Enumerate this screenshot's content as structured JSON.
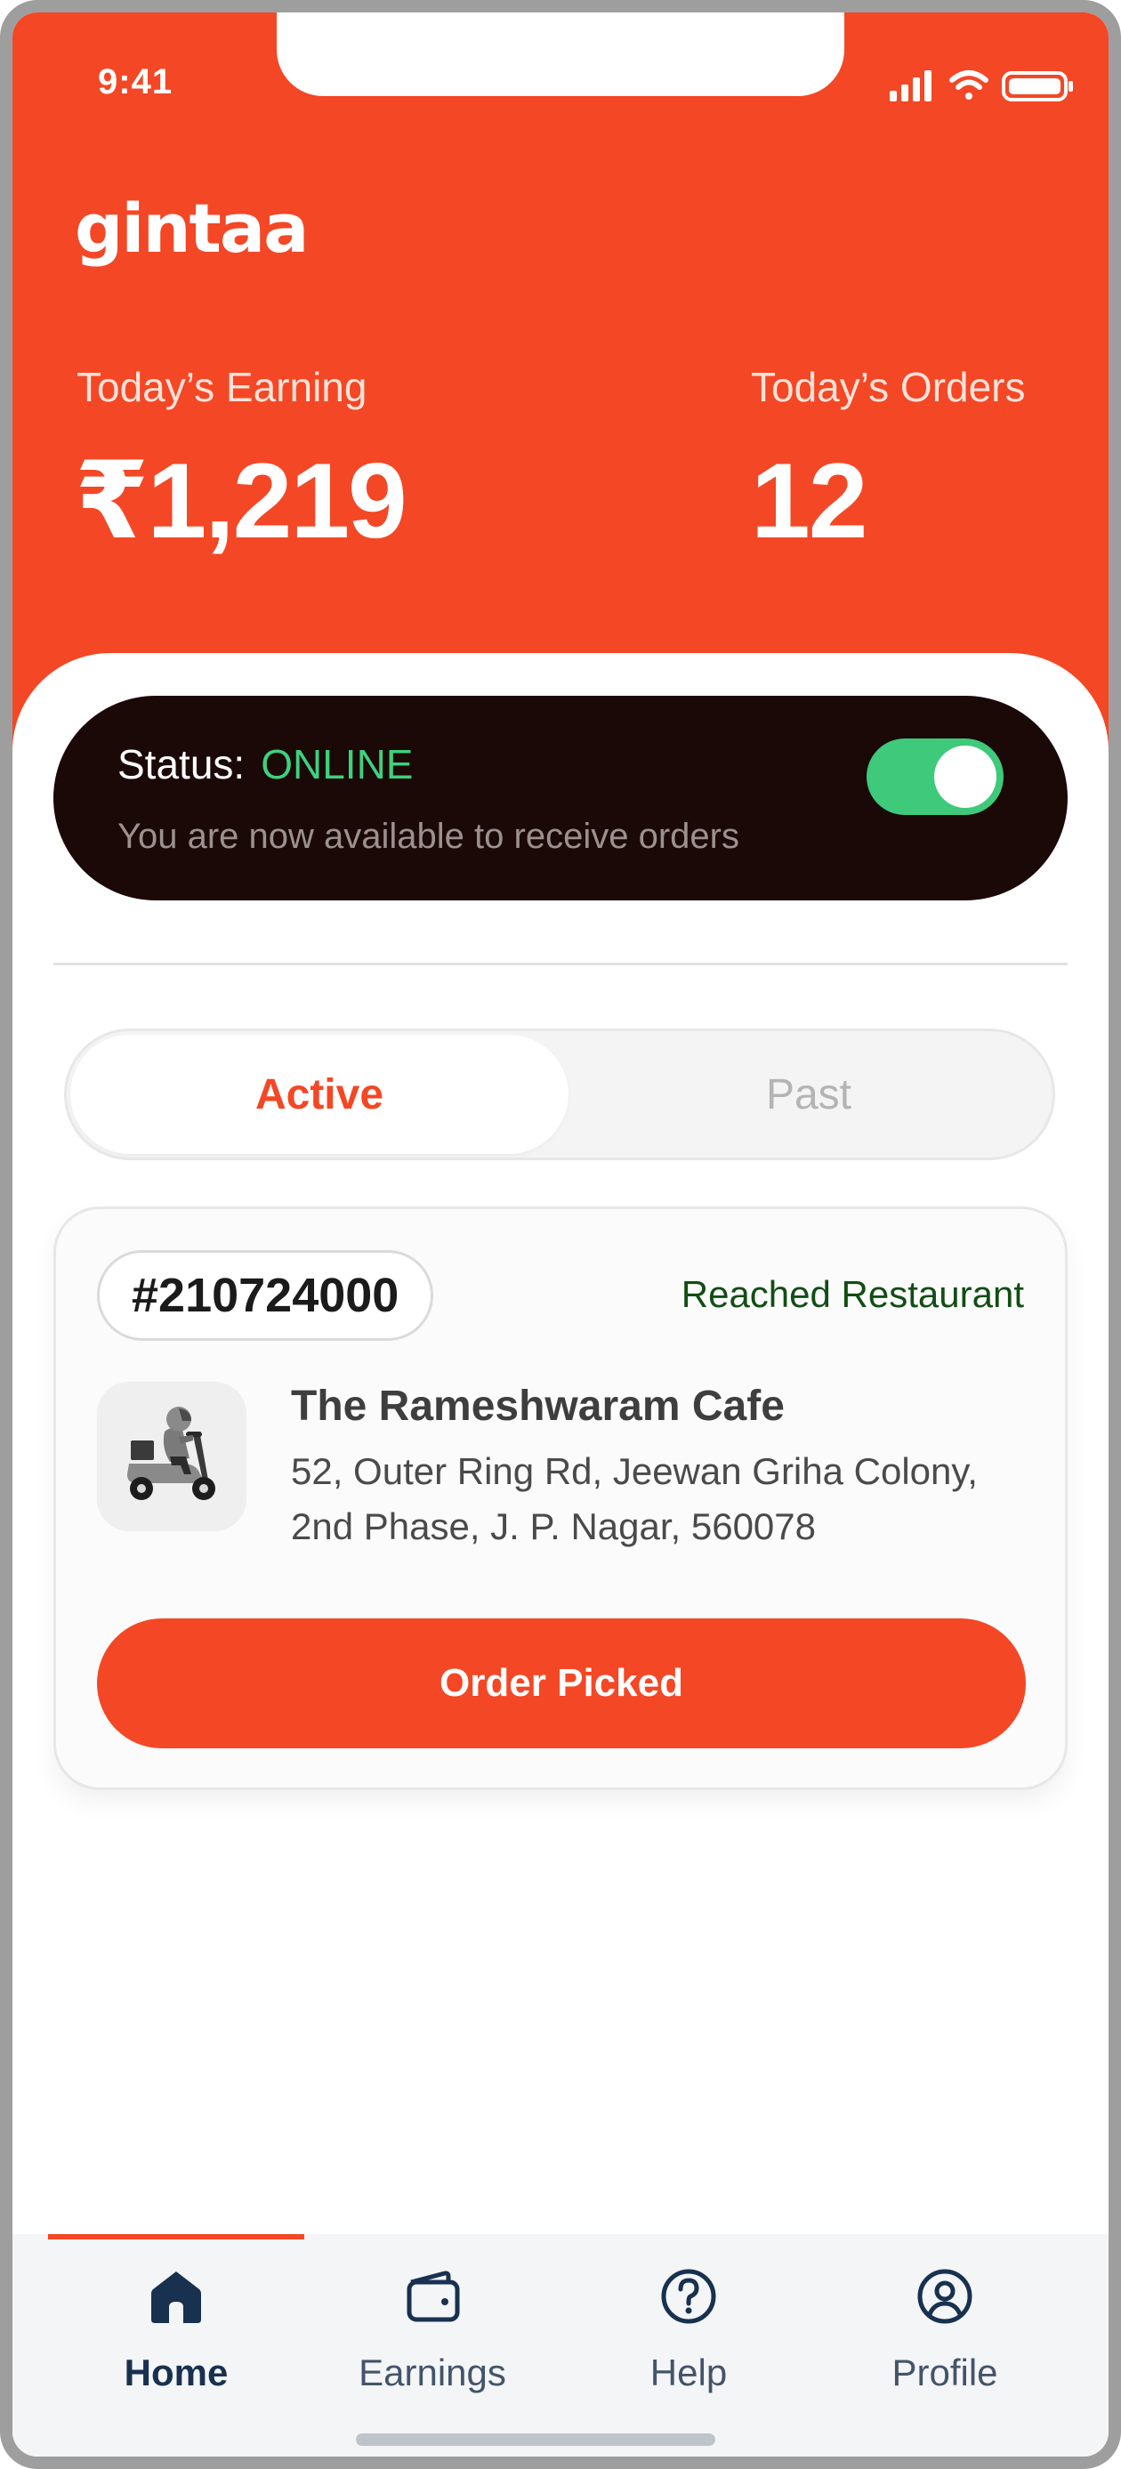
{
  "status_bar": {
    "time": "9:41"
  },
  "header": {
    "logo": "gintaa",
    "earning_label": "Today’s Earning",
    "earning_value": "₹1,219",
    "orders_label": "Today’s Orders",
    "orders_value": "12"
  },
  "status_card": {
    "label": "Status:",
    "value": "ONLINE",
    "subtitle": "You are now available to receive orders",
    "toggle_on": true
  },
  "tabs": [
    {
      "label": "Active",
      "selected": true
    },
    {
      "label": "Past",
      "selected": false
    }
  ],
  "order": {
    "id": "#210724000",
    "status": "Reached Restaurant",
    "restaurant_name": "The Rameshwaram Cafe",
    "address": "52, Outer Ring Rd, Jeewan Griha Colony, 2nd Phase, J. P. Nagar, 560078",
    "action_label": "Order Picked",
    "icon": "scooter-rider-icon"
  },
  "bottom_nav": [
    {
      "label": "Home",
      "icon": "home-icon",
      "selected": true
    },
    {
      "label": "Earnings",
      "icon": "wallet-icon",
      "selected": false
    },
    {
      "label": "Help",
      "icon": "help-icon",
      "selected": false
    },
    {
      "label": "Profile",
      "icon": "profile-icon",
      "selected": false
    }
  ],
  "colors": {
    "brand": "#f44725",
    "status_online": "#3ed07e",
    "order_status": "#114d14",
    "status_card_bg": "#1b0907",
    "nav_active": "#18314f"
  }
}
